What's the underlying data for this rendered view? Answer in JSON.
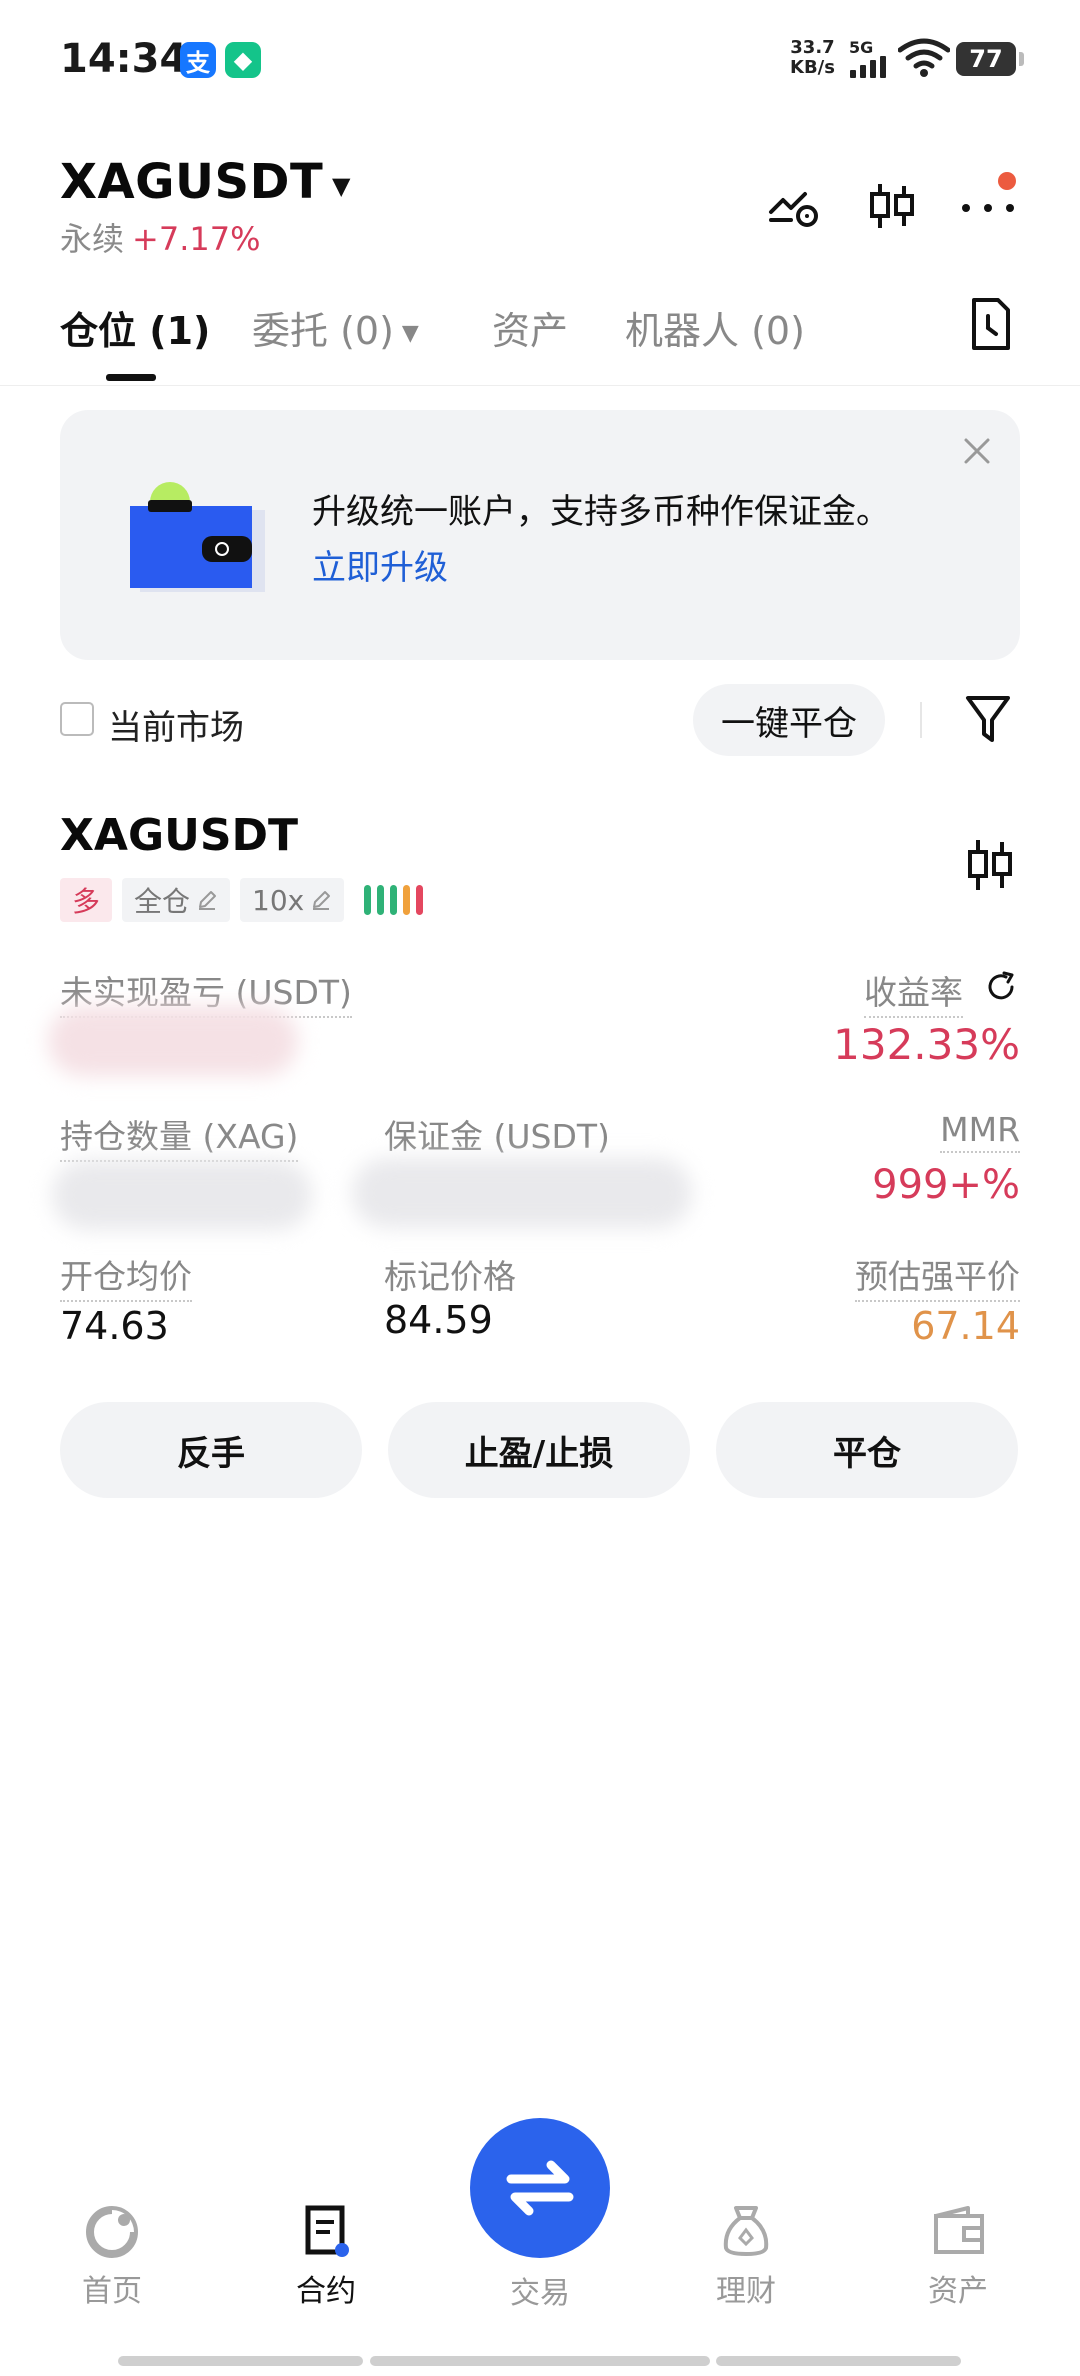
{
  "status_bar": {
    "time": "14:34",
    "app_badge_1": "支",
    "app_badge_2": "◆",
    "net_speed_value": "33.7",
    "net_speed_unit": "KB/s",
    "network": "5G",
    "battery": "77"
  },
  "header": {
    "pair": "XAGUSDT",
    "type": "永续",
    "change": "+7.17%",
    "icons": [
      "trend-alert-icon",
      "candlestick-icon",
      "more-icon"
    ]
  },
  "tabs": {
    "positions": "仓位 (1)",
    "orders": "委托 (0)",
    "assets": "资产",
    "bots": "机器人 (0)"
  },
  "promo": {
    "text": "升级统一账户，支持多币种作保证金。",
    "link": "立即升级"
  },
  "filter": {
    "current_market": "当前市场",
    "close_all": "一键平仓"
  },
  "position": {
    "symbol": "XAGUSDT",
    "side": "多",
    "margin_mode": "全仓",
    "leverage": "10x",
    "risk_colors": [
      "#2fb277",
      "#2fb277",
      "#2fb277",
      "#f0a13c",
      "#e4475f"
    ],
    "unrealized_pnl_label": "未实现盈亏 (USDT)",
    "roe_label": "收益率",
    "roe_value": "132.33%",
    "size_label": "持仓数量 (XAG)",
    "margin_label": "保证金 (USDT)",
    "mmr_label": "MMR",
    "mmr_value": "999+%",
    "entry_label": "开仓均价",
    "entry_value": "74.63",
    "mark_label": "标记价格",
    "mark_value": "84.59",
    "liq_label": "预估强平价",
    "liq_value": "67.14"
  },
  "actions": {
    "reverse": "反手",
    "tp_sl": "止盈/止损",
    "close": "平仓"
  },
  "nav": {
    "home": "首页",
    "contract": "合约",
    "trade": "交易",
    "finance": "理财",
    "assets": "资产"
  },
  "colors": {
    "accent_blue": "#2b63ec",
    "profit_red": "#d63b5a",
    "warning_orange": "#e0934a",
    "link_blue": "#1f5fd6"
  }
}
